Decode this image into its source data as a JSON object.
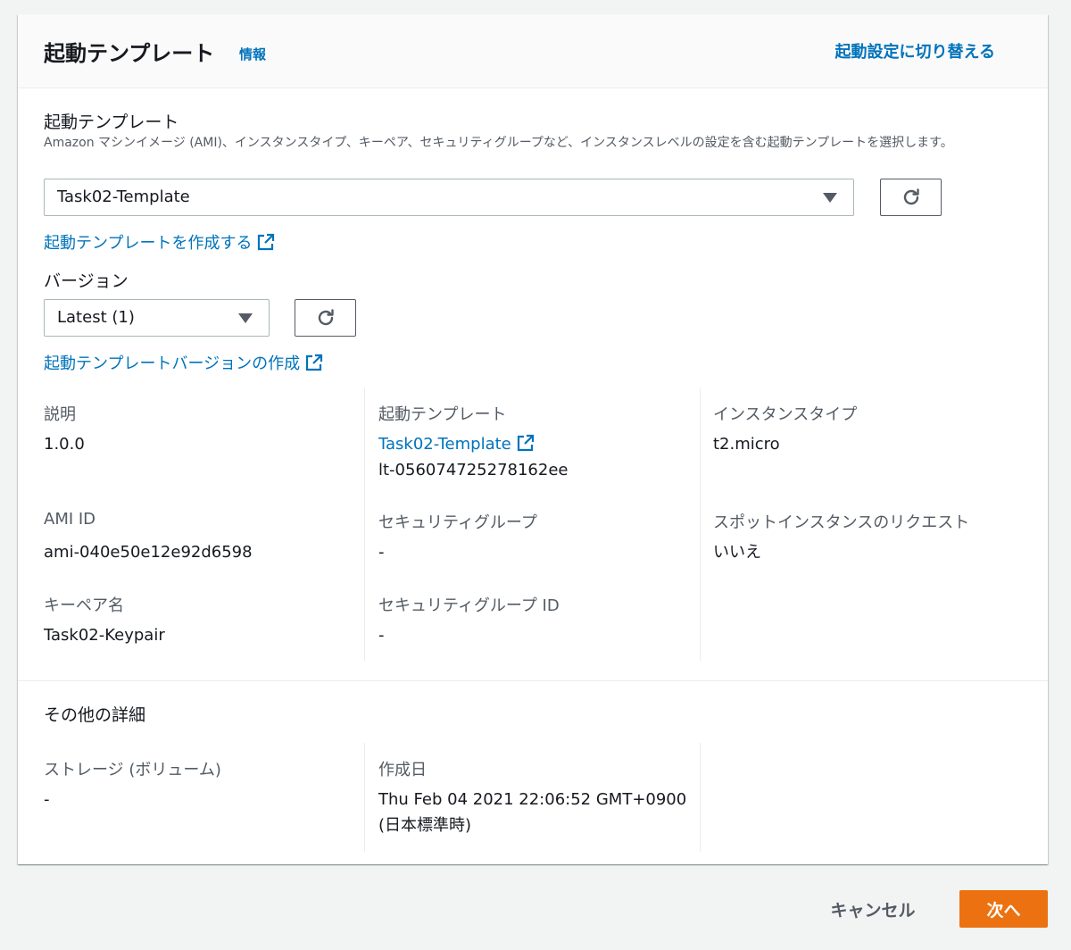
{
  "header": {
    "title": "起動テンプレート",
    "info": "情報",
    "switch_link": "起動設定に切り替える"
  },
  "template_field": {
    "label": "起動テンプレート",
    "description": "Amazon マシンイメージ (AMI)、インスタンスタイプ、キーペア、セキュリティグループなど、インスタンスレベルの設定を含む起動テンプレートを選択します。",
    "selected": "Task02-Template",
    "create_link": "起動テンプレートを作成する"
  },
  "version_field": {
    "label": "バージョン",
    "selected": "Latest (1)",
    "create_link": "起動テンプレートバージョンの作成"
  },
  "details": {
    "description_label": "説明",
    "description_value": "1.0.0",
    "template_label": "起動テンプレート",
    "template_link": "Task02-Template",
    "template_id": "lt-056074725278162ee",
    "instance_type_label": "インスタンスタイプ",
    "instance_type_value": "t2.micro",
    "ami_label": "AMI ID",
    "ami_value": "ami-040e50e12e92d6598",
    "sg_label": "セキュリティグループ",
    "sg_value": "-",
    "spot_label": "スポットインスタンスのリクエスト",
    "spot_value": "いいえ",
    "keypair_label": "キーペア名",
    "keypair_value": "Task02-Keypair",
    "sg_id_label": "セキュリティグループ ID",
    "sg_id_value": "-"
  },
  "other": {
    "title": "その他の詳細",
    "storage_label": "ストレージ (ボリューム)",
    "storage_value": "-",
    "created_label": "作成日",
    "created_value_line1": "Thu Feb 04 2021 22:06:52 GMT+0900",
    "created_value_line2": "(日本標準時)"
  },
  "footer": {
    "cancel": "キャンセル",
    "next": "次へ"
  },
  "colors": {
    "link": "#0073bb",
    "primary": "#ec7211"
  }
}
